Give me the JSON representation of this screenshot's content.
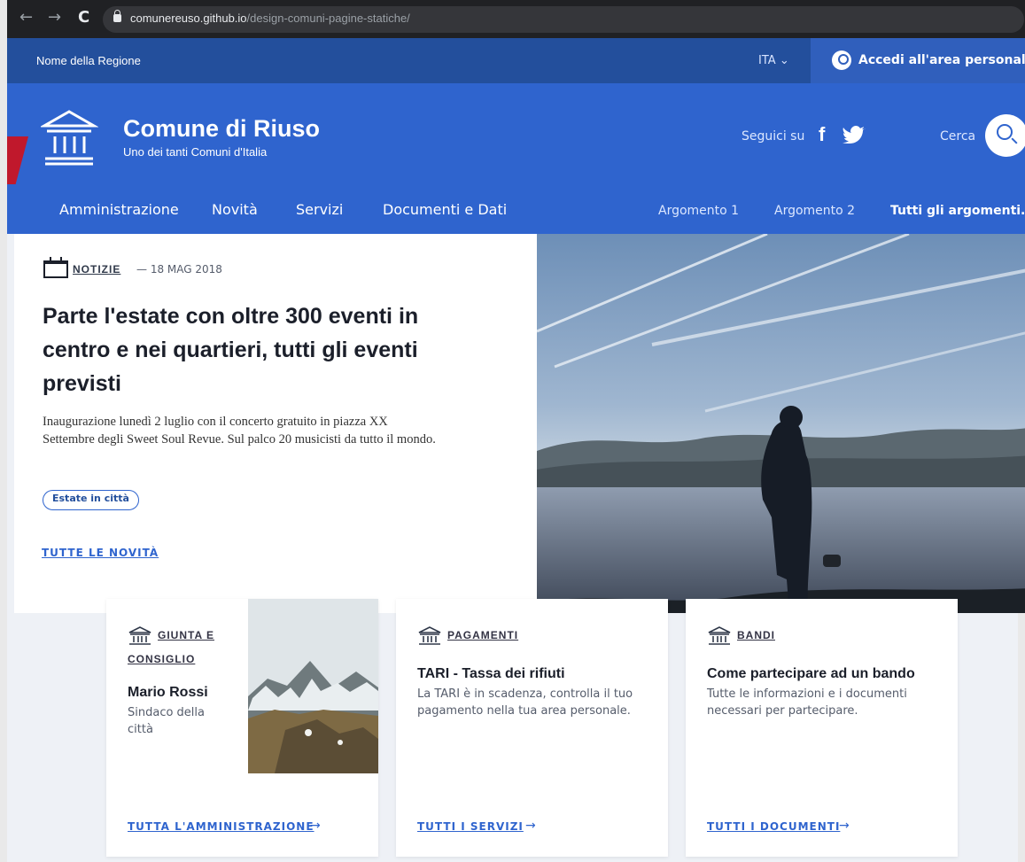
{
  "browser": {
    "nav": {
      "back": "←",
      "forward": "→",
      "reload": "C"
    },
    "url_domain": "comunereuso.github.io",
    "url_path": "/design-comuni-pagine-statiche/"
  },
  "slim_header": {
    "region": "Nome della Regione",
    "language": "ITA",
    "login": "Accedi all'area personale"
  },
  "header": {
    "title": "Comune di Riuso",
    "subtitle": "Uno dei tanti Comuni d'Italia",
    "social_label": "Seguici su",
    "facebook": "f",
    "search_label": "Cerca"
  },
  "navigation": {
    "main": [
      "Amministrazione",
      "Novità",
      "Servizi",
      "Documenti e Dati"
    ],
    "topics": [
      "Argomento 1",
      "Argomento 2",
      "Tutti gli argomenti..."
    ]
  },
  "article": {
    "category": "NOTIZIE",
    "date": "— 18 MAG 2018",
    "title": "Parte l'estate con oltre 300 eventi in centro e nei quartieri, tutti gli eventi previsti",
    "abstract": "Inaugurazione lunedì 2 luglio con il concerto gratuito in piazza XX Settembre degli Sweet Soul Revue. Sul palco 20 musicisti da tutto il mondo.",
    "tag": "Estate in città",
    "link": "TUTTE LE NOVITÀ"
  },
  "cards": [
    {
      "category_line1": "GIUNTA E",
      "category_line2": "CONSIGLIO",
      "title": "Mario Rossi",
      "text": "Sindaco della città",
      "link": "TUTTA L'AMMINISTRAZIONE"
    },
    {
      "category": "PAGAMENTI",
      "title": "TARI - Tassa dei rifiuti",
      "text": "La TARI è in scadenza, controlla il tuo pagamento nella tua area personale.",
      "link": "TUTTI I SERVIZI"
    },
    {
      "category": "BANDI",
      "title": "Come partecipare ad un bando",
      "text": "Tutte le informazioni e i documenti necessari per partecipare.",
      "link": "TUTTI I DOCUMENTI"
    }
  ],
  "icons": {
    "back": "arrow-left-icon",
    "forward": "arrow-right-icon",
    "reload": "reload-icon",
    "lock": "lock-icon",
    "user": "user-icon",
    "building": "building-icon",
    "facebook": "facebook-icon",
    "twitter": "twitter-icon",
    "search": "search-icon",
    "calendar": "calendar-icon",
    "arrow": "arrow-right-icon"
  },
  "colors": {
    "primary": "#2f64ce",
    "dark_primary": "#234f9c",
    "page_bg": "#eef1f6"
  }
}
